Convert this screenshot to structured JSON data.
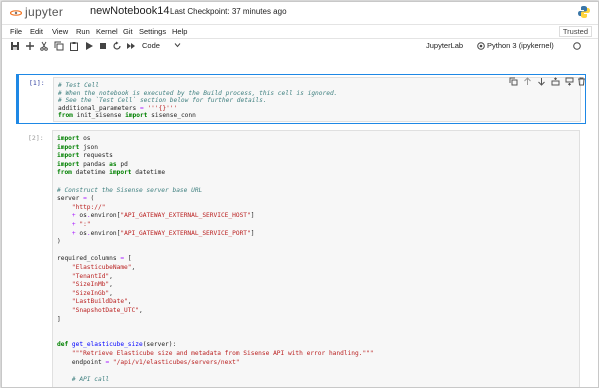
{
  "header": {
    "logo_text": "jupyter",
    "notebook_title": "newNotebook14",
    "checkpoint_text": "Last Checkpoint: 37 minutes ago"
  },
  "menubar": {
    "items": [
      "File",
      "Edit",
      "View",
      "Run",
      "Kernel",
      "Git",
      "Settings",
      "Help"
    ],
    "trusted_label": "Trusted"
  },
  "toolbar": {
    "icons": [
      "save-icon",
      "add-cell-icon",
      "cut-icon",
      "copy-icon",
      "paste-icon",
      "run-icon",
      "stop-icon",
      "restart-icon",
      "fast-forward-icon"
    ],
    "cell_type": "Code",
    "jupyterlab_label": "JupyterLab",
    "kernel_label": "Python 3 (ipykernel)"
  },
  "cells": [
    {
      "prompt": "[1]:",
      "lines": [
        [
          {
            "t": "# Test Cell",
            "c": "com"
          }
        ],
        [
          {
            "t": "# When the notebook is executed by the Build process, this cell is ignored.",
            "c": "com"
          }
        ],
        [
          {
            "t": "# See the `Test Cell` section below for further details.",
            "c": "com"
          }
        ],
        [
          {
            "t": "additional_parameters ",
            "c": ""
          },
          {
            "t": "=",
            "c": "op"
          },
          {
            "t": " ",
            "c": ""
          },
          {
            "t": "'''{}'''",
            "c": "str"
          }
        ],
        [
          {
            "t": "from",
            "c": "kw"
          },
          {
            "t": " init_sisense ",
            "c": ""
          },
          {
            "t": "import",
            "c": "kw"
          },
          {
            "t": " sisense_conn",
            "c": ""
          }
        ]
      ]
    },
    {
      "prompt": "[2]:",
      "lines": [
        [
          {
            "t": "import",
            "c": "kw"
          },
          {
            "t": " os",
            "c": ""
          }
        ],
        [
          {
            "t": "import",
            "c": "kw"
          },
          {
            "t": " json",
            "c": ""
          }
        ],
        [
          {
            "t": "import",
            "c": "kw"
          },
          {
            "t": " requests",
            "c": ""
          }
        ],
        [
          {
            "t": "import",
            "c": "kw"
          },
          {
            "t": " pandas ",
            "c": ""
          },
          {
            "t": "as",
            "c": "kw"
          },
          {
            "t": " pd",
            "c": ""
          }
        ],
        [
          {
            "t": "from",
            "c": "kw"
          },
          {
            "t": " datetime ",
            "c": ""
          },
          {
            "t": "import",
            "c": "kw"
          },
          {
            "t": " datetime",
            "c": ""
          }
        ],
        [],
        [
          {
            "t": "# Construct the Sisense server base URL",
            "c": "com"
          }
        ],
        [
          {
            "t": "server ",
            "c": ""
          },
          {
            "t": "=",
            "c": "op"
          },
          {
            "t": " (",
            "c": ""
          }
        ],
        [
          {
            "t": "    ",
            "c": ""
          },
          {
            "t": "\"http://\"",
            "c": "str"
          }
        ],
        [
          {
            "t": "    ",
            "c": ""
          },
          {
            "t": "+",
            "c": "op"
          },
          {
            "t": " os",
            "c": ""
          },
          {
            "t": ".",
            "c": "op"
          },
          {
            "t": "environ[",
            "c": ""
          },
          {
            "t": "\"API_GATEWAY_EXTERNAL_SERVICE_HOST\"",
            "c": "str"
          },
          {
            "t": "]",
            "c": ""
          }
        ],
        [
          {
            "t": "    ",
            "c": ""
          },
          {
            "t": "+",
            "c": "op"
          },
          {
            "t": " ",
            "c": ""
          },
          {
            "t": "\":\"",
            "c": "str"
          }
        ],
        [
          {
            "t": "    ",
            "c": ""
          },
          {
            "t": "+",
            "c": "op"
          },
          {
            "t": " os",
            "c": ""
          },
          {
            "t": ".",
            "c": "op"
          },
          {
            "t": "environ[",
            "c": ""
          },
          {
            "t": "\"API_GATEWAY_EXTERNAL_SERVICE_PORT\"",
            "c": "str"
          },
          {
            "t": "]",
            "c": ""
          }
        ],
        [
          {
            "t": ")",
            "c": ""
          }
        ],
        [],
        [
          {
            "t": "required_columns ",
            "c": ""
          },
          {
            "t": "=",
            "c": "op"
          },
          {
            "t": " [",
            "c": ""
          }
        ],
        [
          {
            "t": "    ",
            "c": ""
          },
          {
            "t": "\"ElasticubeName\"",
            "c": "str"
          },
          {
            "t": ",",
            "c": ""
          }
        ],
        [
          {
            "t": "    ",
            "c": ""
          },
          {
            "t": "\"TenantId\"",
            "c": "str"
          },
          {
            "t": ",",
            "c": ""
          }
        ],
        [
          {
            "t": "    ",
            "c": ""
          },
          {
            "t": "\"SizeInMb\"",
            "c": "str"
          },
          {
            "t": ",",
            "c": ""
          }
        ],
        [
          {
            "t": "    ",
            "c": ""
          },
          {
            "t": "\"SizeInGb\"",
            "c": "str"
          },
          {
            "t": ",",
            "c": ""
          }
        ],
        [
          {
            "t": "    ",
            "c": ""
          },
          {
            "t": "\"LastBuildDate\"",
            "c": "str"
          },
          {
            "t": ",",
            "c": ""
          }
        ],
        [
          {
            "t": "    ",
            "c": ""
          },
          {
            "t": "\"SnapshotDate_UTC\"",
            "c": "str"
          },
          {
            "t": ",",
            "c": ""
          }
        ],
        [
          {
            "t": "]",
            "c": ""
          }
        ],
        [],
        [],
        [
          {
            "t": "def",
            "c": "kw"
          },
          {
            "t": " ",
            "c": ""
          },
          {
            "t": "get_elasticube_size",
            "c": "fn"
          },
          {
            "t": "(server):",
            "c": ""
          }
        ],
        [
          {
            "t": "    ",
            "c": ""
          },
          {
            "t": "\"\"\"Retrieve Elasticube size and metadata from Sisense API with error handling.\"\"\"",
            "c": "str"
          }
        ],
        [
          {
            "t": "    endpoint ",
            "c": ""
          },
          {
            "t": "=",
            "c": "op"
          },
          {
            "t": " ",
            "c": ""
          },
          {
            "t": "\"/api/v1/elasticubes/servers/next\"",
            "c": "str"
          }
        ],
        [],
        [
          {
            "t": "    ",
            "c": ""
          },
          {
            "t": "# API call",
            "c": "com"
          }
        ]
      ]
    }
  ]
}
